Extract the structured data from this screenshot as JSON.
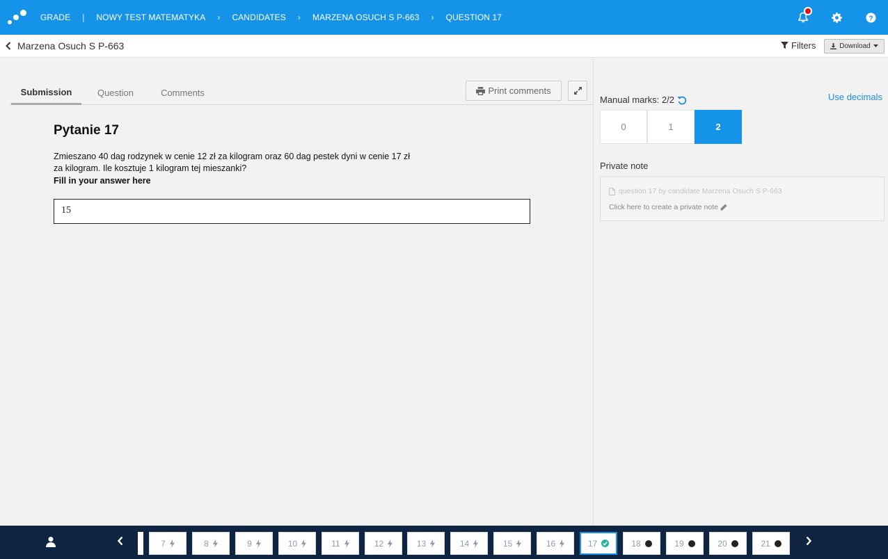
{
  "topbar": {
    "breadcrumbs": [
      {
        "label": "GRADE"
      },
      {
        "label": "NOWY TEST MATEMATYKA"
      },
      {
        "label": "CANDIDATES"
      },
      {
        "label": "MARZENA OSUCH S P-663"
      },
      {
        "label": "QUESTION 17"
      }
    ],
    "sep_pipe": "|",
    "sep_chev": "›"
  },
  "subbar": {
    "back_label": "Marzena Osuch S P-663",
    "filters_label": "Filters",
    "download_label": "Download"
  },
  "tabs": {
    "submission": "Submission",
    "question": "Question",
    "comments": "Comments"
  },
  "print_label": "Print comments",
  "question": {
    "title": "Pytanie 17",
    "text": "Zmieszano 40 dag rodzynek w cenie 12 zł za kilogram oraz 60 dag pestek dyni w cenie 17 zł za kilogram. Ile kosztuje 1 kilogram tej mieszanki?",
    "prompt": "Fill in your answer here",
    "answer": "15"
  },
  "marking": {
    "marks_label": "Manual marks: 2/2",
    "use_decimals": "Use decimals",
    "options": [
      "0",
      "1",
      "2"
    ],
    "selected": "2"
  },
  "private_note": {
    "label": "Private note",
    "title": "question 17 by candidate Marzena Osuch S P-663",
    "placeholder": "Click here to create a private note"
  },
  "question_nav": [
    {
      "num": "7",
      "status": "flash"
    },
    {
      "num": "8",
      "status": "flash"
    },
    {
      "num": "9",
      "status": "flash"
    },
    {
      "num": "10",
      "status": "flash"
    },
    {
      "num": "11",
      "status": "flash"
    },
    {
      "num": "12",
      "status": "flash"
    },
    {
      "num": "13",
      "status": "flash"
    },
    {
      "num": "14",
      "status": "flash"
    },
    {
      "num": "15",
      "status": "flash"
    },
    {
      "num": "16",
      "status": "flash"
    },
    {
      "num": "17",
      "status": "check"
    },
    {
      "num": "18",
      "status": "dot"
    },
    {
      "num": "19",
      "status": "dot"
    },
    {
      "num": "20",
      "status": "dot"
    },
    {
      "num": "21",
      "status": "dot"
    }
  ],
  "colors": {
    "primary": "#1593e9",
    "navy": "#0f2440",
    "check": "#2bb39b"
  }
}
